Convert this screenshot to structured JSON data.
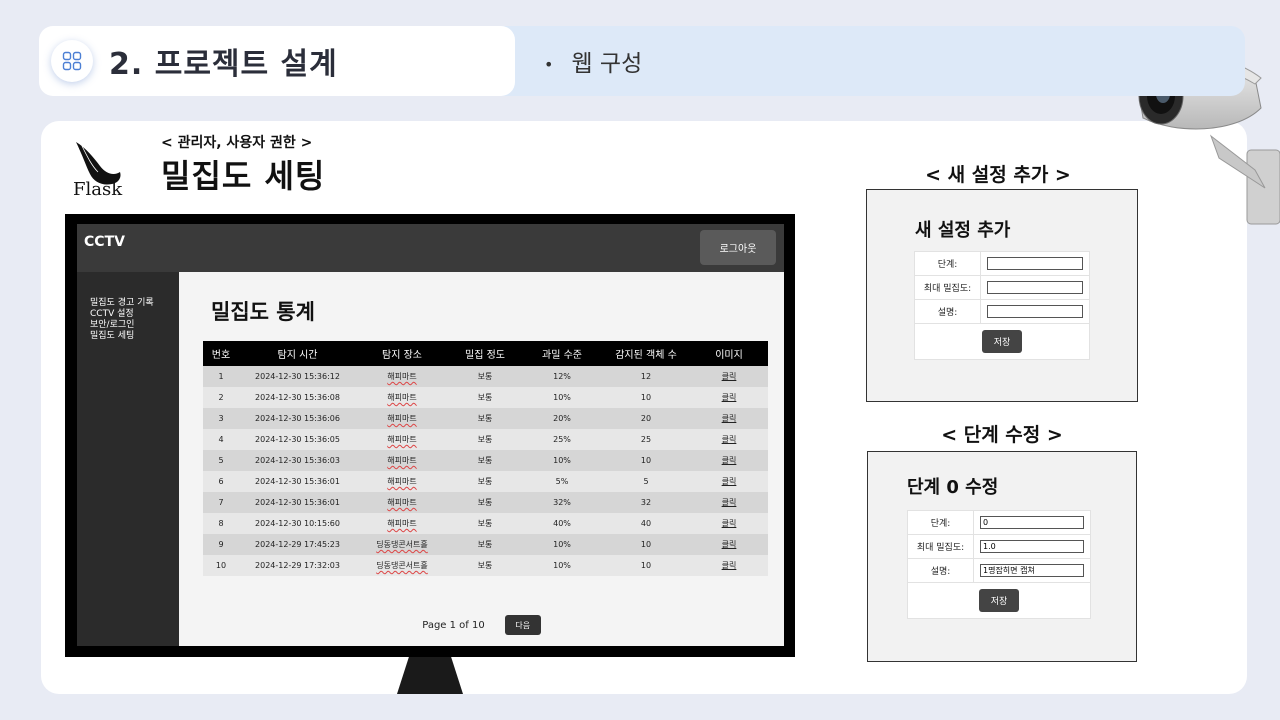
{
  "header": {
    "title": "2. 프로젝트 설계",
    "bullet": "웹 구성",
    "bullet_dot": "•"
  },
  "slide": {
    "logo_text": "Flask",
    "subtitle": "< 관리자, 사용자 권한 >",
    "title": "밀집도 세팅"
  },
  "app": {
    "brand": "CCTV",
    "logout_label": "로그아웃",
    "sidebar_items": [
      "밀집도 경고 기록",
      "CCTV 설정",
      "보안/로그인",
      "밀집도 세팅"
    ],
    "stats_title": "밀집도 통계",
    "table": {
      "columns": [
        "번호",
        "탐지 시간",
        "탐지 장소",
        "밀집 정도",
        "과밀 수준",
        "감지된 객체 수",
        "이미지"
      ],
      "rows": [
        [
          "1",
          "2024-12-30 15:36:12",
          "해피마트",
          "보통",
          "12%",
          "12",
          "클릭"
        ],
        [
          "2",
          "2024-12-30 15:36:08",
          "해피마트",
          "보통",
          "10%",
          "10",
          "클릭"
        ],
        [
          "3",
          "2024-12-30 15:36:06",
          "해피마트",
          "보통",
          "20%",
          "20",
          "클릭"
        ],
        [
          "4",
          "2024-12-30 15:36:05",
          "해피마트",
          "보통",
          "25%",
          "25",
          "클릭"
        ],
        [
          "5",
          "2024-12-30 15:36:03",
          "해피마트",
          "보통",
          "10%",
          "10",
          "클릭"
        ],
        [
          "6",
          "2024-12-30 15:36:01",
          "해피마트",
          "보통",
          "5%",
          "5",
          "클릭"
        ],
        [
          "7",
          "2024-12-30 15:36:01",
          "해피마트",
          "보통",
          "32%",
          "32",
          "클릭"
        ],
        [
          "8",
          "2024-12-30 10:15:60",
          "해피마트",
          "보통",
          "40%",
          "40",
          "클릭"
        ],
        [
          "9",
          "2024-12-29 17:45:23",
          "딩동댕콘서트홀",
          "보통",
          "10%",
          "10",
          "클릭"
        ],
        [
          "10",
          "2024-12-29 17:32:03",
          "딩동댕콘서트홀",
          "보통",
          "10%",
          "10",
          "클릭"
        ]
      ]
    },
    "pagination": {
      "info": "Page 1 of 10",
      "next_label": "다음"
    }
  },
  "new_setting": {
    "section_label": "< 새 설정 추가 >",
    "title": "새 설정 추가",
    "level_label": "단계:",
    "max_density_label": "최대 밀집도:",
    "description_label": "설명:",
    "level_value": "",
    "max_density_value": "",
    "description_value": "",
    "save_label": "저장"
  },
  "edit_level": {
    "section_label": "< 단계 수정 >",
    "title": "단계 0 수정",
    "level_label": "단계:",
    "max_density_label": "최대 밀집도:",
    "description_label": "설명:",
    "level_value": "0",
    "max_density_value": "1.0",
    "description_value": "1명잡히면 캡쳐",
    "save_label": "저장"
  },
  "colors": {
    "page_bg": "#e8ebf4",
    "header_accent": "#dde9f8",
    "app_topbar": "#3a3a3a",
    "app_sidebar": "#2b2b2b",
    "table_header": "#000000"
  }
}
